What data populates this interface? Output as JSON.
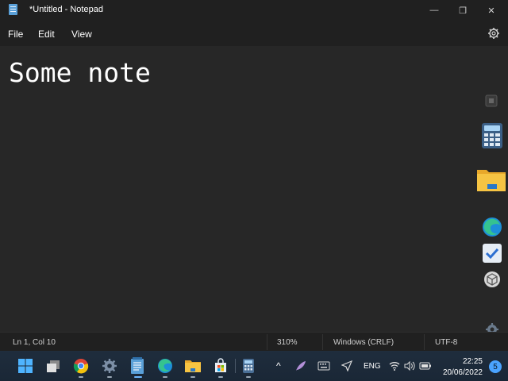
{
  "window": {
    "title": "*Untitled - Notepad",
    "controls": {
      "minimize": "—",
      "maximize": "❐",
      "close": "✕"
    }
  },
  "menu": {
    "items": [
      "File",
      "Edit",
      "View"
    ],
    "settings_icon": "gear-icon"
  },
  "editor": {
    "content": "Some note"
  },
  "side_dock": {
    "icons": [
      "app-icon",
      "calculator-icon",
      "file-explorer-icon",
      "edge-icon",
      "todo-icon",
      "cube-icon",
      "gear-icon"
    ]
  },
  "status": {
    "position": "Ln 1, Col 10",
    "zoom": "310%",
    "line_ending": "Windows (CRLF)",
    "encoding": "UTF-8"
  },
  "taskbar": {
    "apps": [
      "start-icon",
      "task-view-icon",
      "chrome-icon",
      "settings-icon",
      "notepad-icon",
      "edge-icon",
      "file-explorer-icon",
      "store-icon",
      "calculator-icon"
    ],
    "tray": {
      "chevron": "^",
      "language": "ENG",
      "time": "22:25",
      "date": "20/06/2022",
      "notifications": "5"
    }
  },
  "colors": {
    "editor_bg": "#272727",
    "chrome_bg": "#202020",
    "taskbar_bg": "#1c2a3a",
    "accent": "#4aa3ff"
  }
}
